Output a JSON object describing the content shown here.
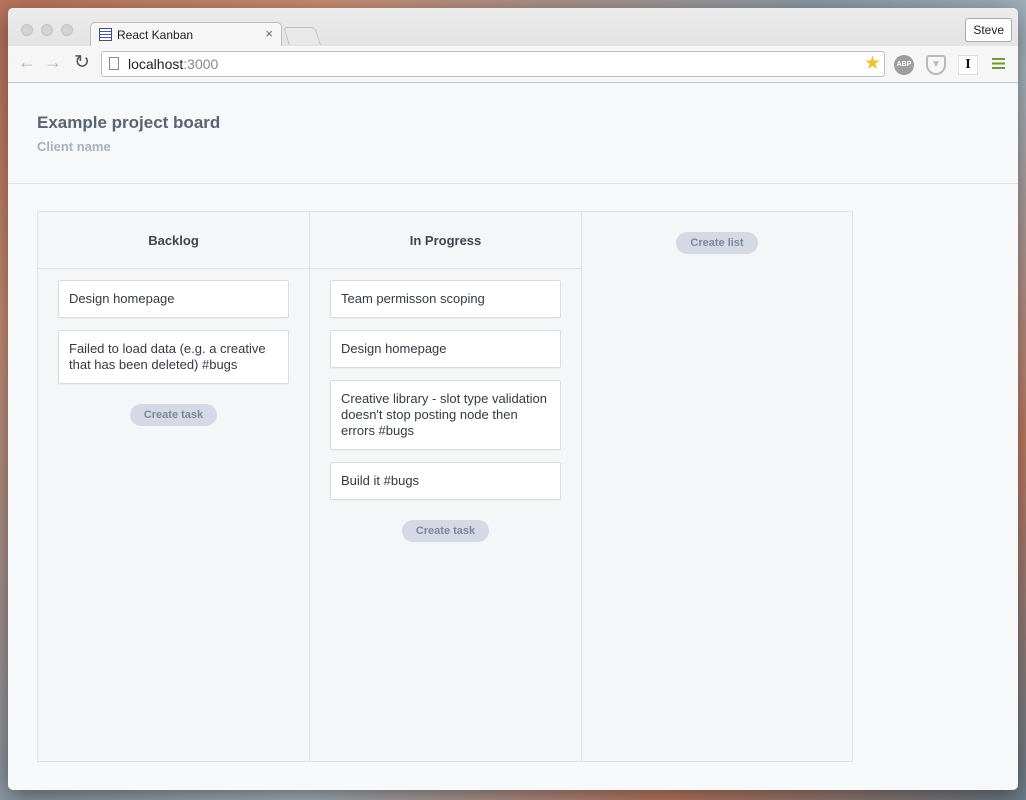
{
  "browser": {
    "tab_title": "React Kanban",
    "tab_close": "×",
    "profile": "Steve",
    "url_host": "localhost",
    "url_port": ":3000",
    "extensions": {
      "abp": "ABP",
      "instapaper": "I"
    }
  },
  "header": {
    "title": "Example project board",
    "client": "Client name"
  },
  "lists": [
    {
      "title": "Backlog",
      "cards": [
        "Design homepage",
        "Failed to load data (e.g. a creative that has been deleted) #bugs"
      ],
      "create_label": "Create task"
    },
    {
      "title": "In Progress",
      "cards": [
        "Team permisson scoping",
        "Design homepage",
        "Creative library - slot type validation doesn't stop posting node then errors #bugs",
        "Build it #bugs"
      ],
      "create_label": "Create task"
    }
  ],
  "create_list_label": "Create list",
  "colors": {
    "pill_bg": "#d5d9e6",
    "title": "#5a6370",
    "subtitle": "#a7b2bd"
  }
}
